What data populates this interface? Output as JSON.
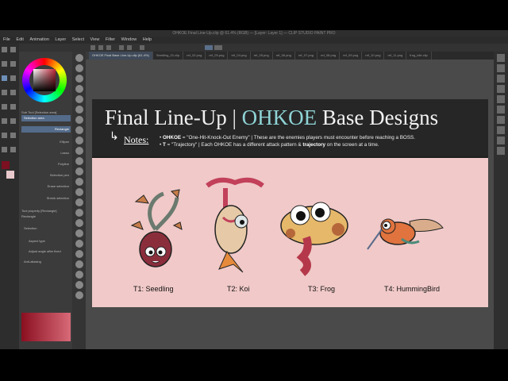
{
  "window": {
    "title": "OHKOE Final Line-Up.clip @ 61.4% (RGB) — [Layer: Layer 1] — CLIP STUDIO PAINT PRO"
  },
  "menu": [
    "File",
    "Edit",
    "Animation",
    "Layer",
    "Select",
    "View",
    "Filter",
    "Window",
    "Help"
  ],
  "tabs": [
    "OHKOE Final Base Line-Up.clip (61.4%)",
    "Seedling_01.clip",
    "ref_02.png",
    "ref_03.png",
    "ref_04.png",
    "ref_05.png",
    "ref_06.png",
    "ref_07.png",
    "ref_08.png",
    "ref_09.png",
    "ref_10.png",
    "ref_11.png",
    "frog_idle.clip"
  ],
  "sub_tool": {
    "header": "Sub Tool [Selection area]",
    "selected": "Selection area",
    "items": [
      "Rectangle",
      "Ellipse",
      "Lasso",
      "Polyline",
      "Selection pen",
      "Erase selection",
      "Shrink selection"
    ]
  },
  "tool_property": {
    "header": "Tool property [Rectangle]",
    "name": "Rectangle",
    "rows": [
      "Selection",
      "Aspect type",
      "Adjust angle after fixed",
      "Anti-aliasing"
    ]
  },
  "slide": {
    "title_pre": "Final Line-Up | ",
    "title_accent": "OHKOE",
    "title_post": " Base Designs",
    "notes_label": "Notes:",
    "note1_bold": "OHKOE",
    "note1_text": " = \"One-Hit-Knock-Out Enemy\" | These are the enemies players must encounter before reaching a BOSS.",
    "note2_bold": "T",
    "note2_text": " = \"Trajectory\" | Each OHKOE has a different attack pattern & ",
    "note2_bold2": "trajectory",
    "note2_tail": " on the screen at a time.",
    "characters": [
      {
        "label": "T1: Seedling"
      },
      {
        "label": "T2: Koi"
      },
      {
        "label": "T3: Frog"
      },
      {
        "label": "T4: HummingBird"
      }
    ]
  },
  "colors": {
    "accent": "#8fd4d6",
    "pink_bg": "#f0c9c8",
    "slide_bg": "#1e1e1e"
  }
}
